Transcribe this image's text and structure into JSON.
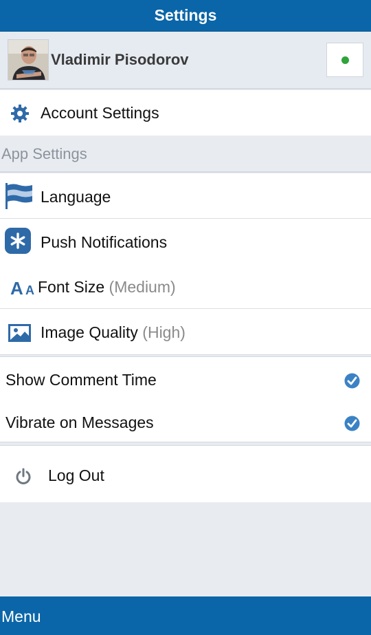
{
  "header": {
    "title": "Settings"
  },
  "profile": {
    "name": "Vladimir Pisodorov",
    "status_color": "#2ea43a"
  },
  "account": {
    "label": "Account Settings",
    "icon": "gear-icon"
  },
  "app_settings": {
    "header": "App Settings",
    "items": [
      {
        "label": "Language",
        "value": "",
        "icon": "flag-icon"
      },
      {
        "label": "Push Notifications",
        "value": "",
        "icon": "asterisk-icon"
      },
      {
        "label": "Font Size",
        "value": "(Medium)",
        "icon": "font-size-icon"
      },
      {
        "label": "Image Quality",
        "value": "(High)",
        "icon": "image-icon"
      }
    ]
  },
  "toggles": [
    {
      "label": "Show Comment Time",
      "checked": true
    },
    {
      "label": "Vibrate on Messages",
      "checked": true
    }
  ],
  "logout": {
    "label": "Log Out",
    "icon": "power-icon"
  },
  "footer": {
    "menu_label": "Menu"
  },
  "colors": {
    "accent": "#0a66a8",
    "check": "#3b82c4",
    "icon_blue": "#2f6aa8"
  }
}
